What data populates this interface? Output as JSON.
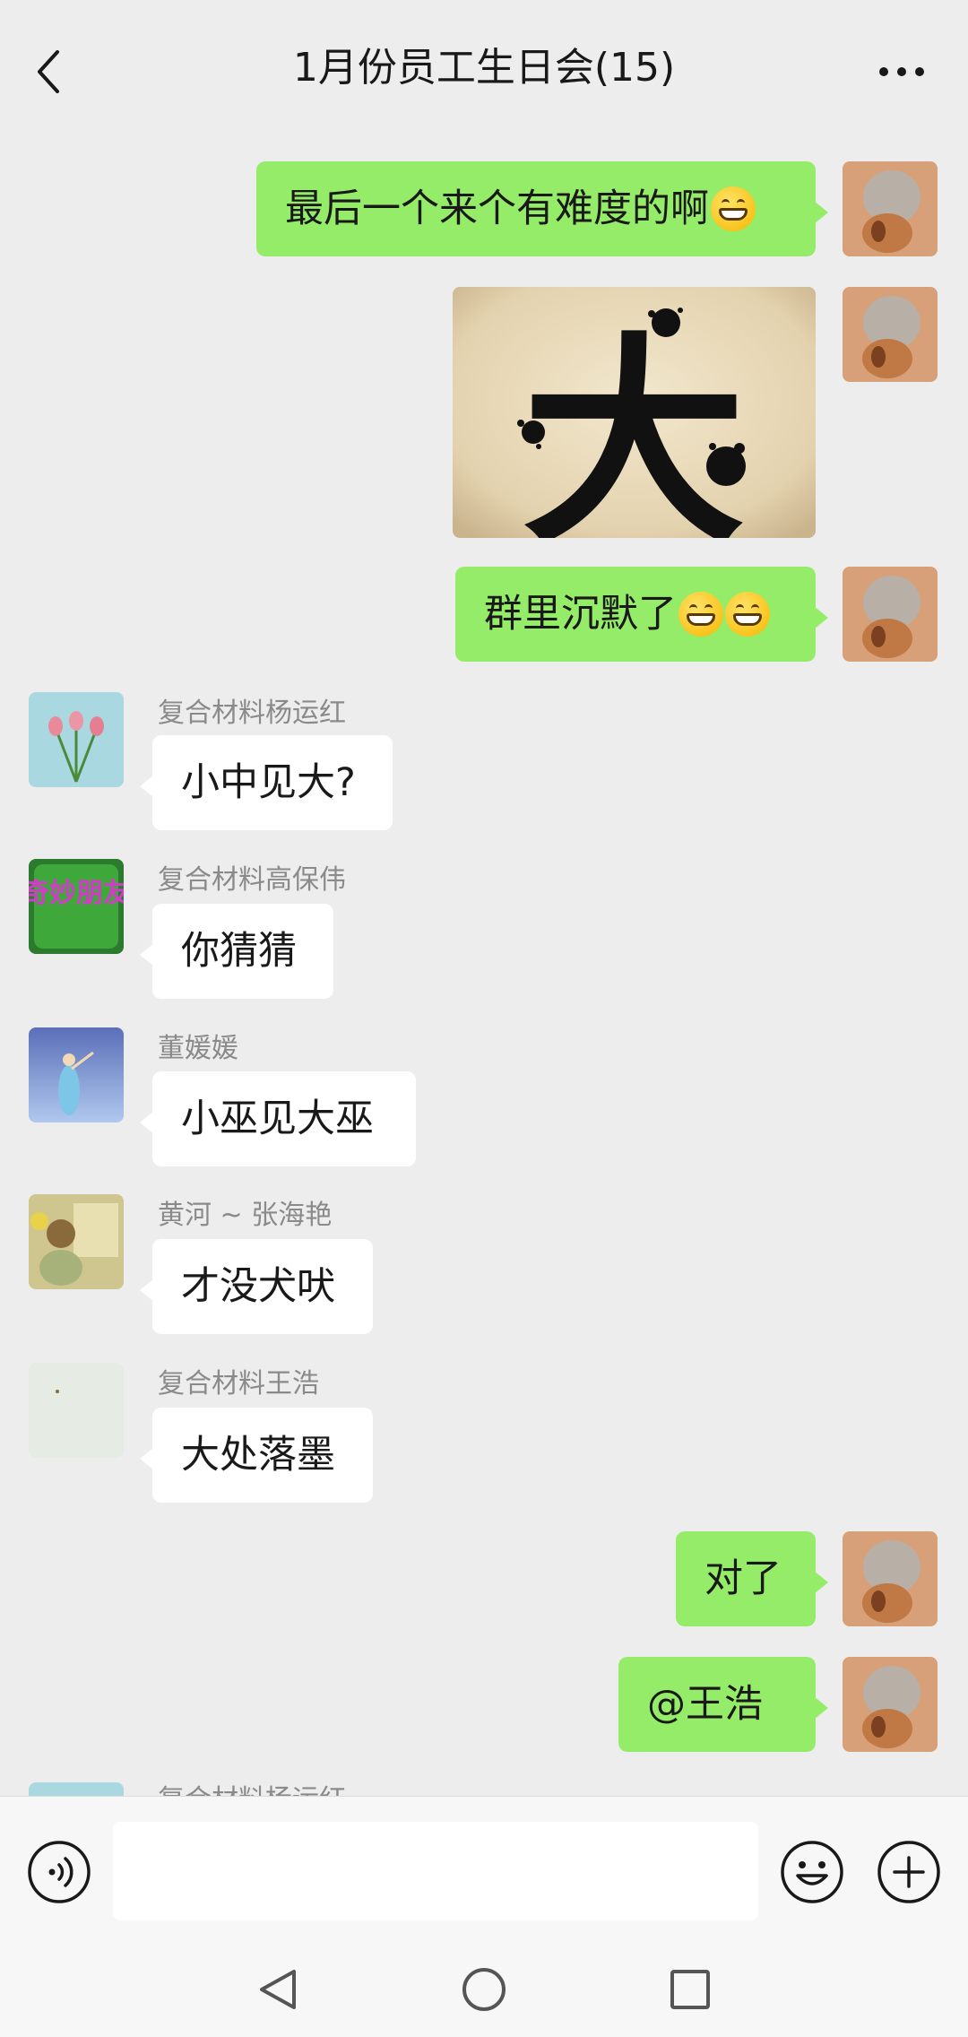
{
  "header": {
    "title": "1月份员工生日会(15)"
  },
  "messages": [
    {
      "side": "out",
      "text": "最后一个来个有难度的啊",
      "emoji_count": 1
    },
    {
      "side": "out",
      "type": "image",
      "image_text": "大"
    },
    {
      "side": "out",
      "text": "群里沉默了",
      "emoji_count": 2
    },
    {
      "side": "in",
      "sender": "复合材料杨运红",
      "text": "小中见大?"
    },
    {
      "side": "in",
      "sender": "复合材料高保伟",
      "text": "你猜猜",
      "avatar_text": "奇妙朋友"
    },
    {
      "side": "in",
      "sender": "董媛媛",
      "text": "小巫见大巫"
    },
    {
      "side": "in",
      "sender": "黄河 ~ 张海艳",
      "text": "才没犬吠"
    },
    {
      "side": "in",
      "sender": "复合材料王浩",
      "text": "大处落墨"
    },
    {
      "side": "out",
      "text": "对了"
    },
    {
      "side": "out",
      "text": "@王浩"
    },
    {
      "side": "in",
      "sender": "复合材料杨运红",
      "partial": true
    }
  ],
  "icons": {
    "back": "chevron-left-icon",
    "more": "more-dots-icon",
    "voice": "voice-icon",
    "emoji": "emoji-smile-icon",
    "plus": "plus-circle-icon",
    "emoji_in_text": "grinning-emoji"
  },
  "colors": {
    "background": "#EDEDED",
    "outgoing_bubble": "#95EC69",
    "incoming_bubble": "#FFFFFF",
    "sender_name": "#8A8A8A"
  }
}
